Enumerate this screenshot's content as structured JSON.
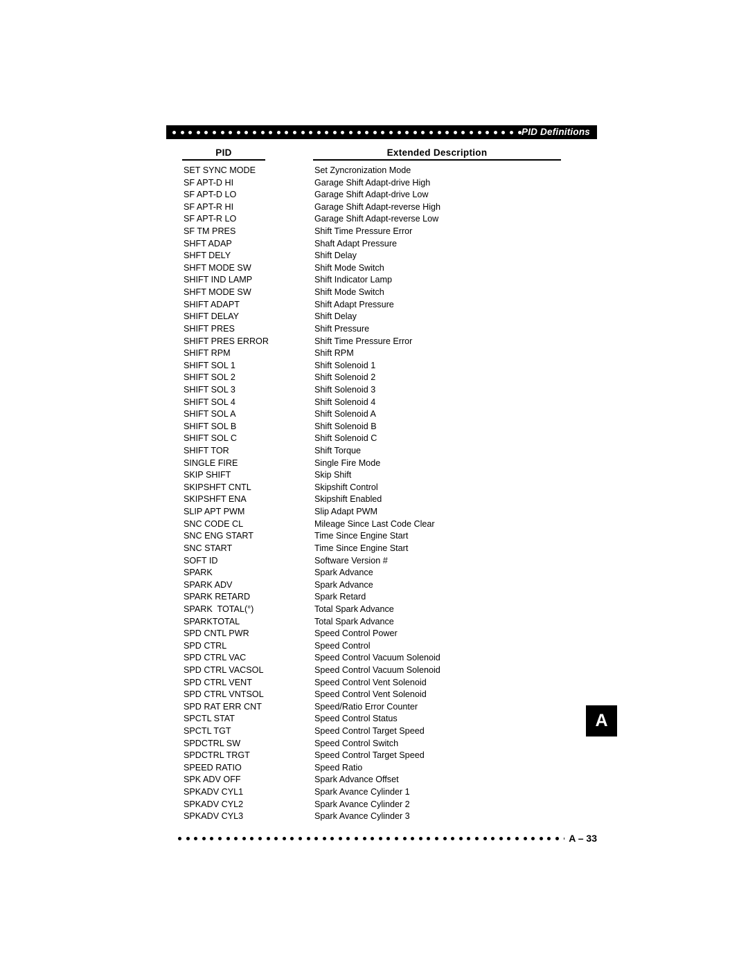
{
  "header": {
    "title": "PID Definitions",
    "dot_count": 47,
    "background_color": "#000000",
    "dot_color": "#ffffff"
  },
  "columns": {
    "pid_header": "PID",
    "description_header": "Extended Description"
  },
  "side_tab": {
    "label": "A",
    "background_color": "#000000",
    "text_color": "#ffffff"
  },
  "footer": {
    "page_label": "A – 33",
    "dot_count": 60,
    "dot_color": "#000000"
  },
  "rows": [
    {
      "pid": "SET SYNC MODE",
      "description": "Set Zyncronization Mode"
    },
    {
      "pid": "SF APT-D HI",
      "description": "Garage Shift Adapt-drive High"
    },
    {
      "pid": "SF APT-D LO",
      "description": "Garage Shift Adapt-drive Low"
    },
    {
      "pid": "SF APT-R HI",
      "description": "Garage Shift Adapt-reverse High"
    },
    {
      "pid": "SF APT-R LO",
      "description": "Garage Shift Adapt-reverse Low"
    },
    {
      "pid": "SF TM PRES",
      "description": "Shift Time Pressure Error"
    },
    {
      "pid": "SHFT ADAP",
      "description": "Shaft Adapt Pressure"
    },
    {
      "pid": "SHFT DELY",
      "description": "Shift Delay"
    },
    {
      "pid": "SHFT MODE SW",
      "description": "Shift Mode Switch"
    },
    {
      "pid": "SHIFT IND LAMP",
      "description": "Shift Indicator Lamp"
    },
    {
      "pid": "SHFT MODE SW",
      "description": "Shift Mode Switch"
    },
    {
      "pid": "SHIFT ADAPT",
      "description": "Shift Adapt Pressure"
    },
    {
      "pid": "SHIFT DELAY",
      "description": "Shift Delay"
    },
    {
      "pid": "SHIFT PRES",
      "description": "Shift Pressure"
    },
    {
      "pid": "SHIFT PRES ERROR",
      "description": "Shift Time Pressure Error"
    },
    {
      "pid": "SHIFT RPM",
      "description": "Shift RPM"
    },
    {
      "pid": "SHIFT SOL 1",
      "description": "Shift Solenoid 1"
    },
    {
      "pid": "SHIFT SOL 2",
      "description": "Shift Solenoid 2"
    },
    {
      "pid": "SHIFT SOL 3",
      "description": "Shift Solenoid 3"
    },
    {
      "pid": "SHIFT SOL 4",
      "description": "Shift Solenoid 4"
    },
    {
      "pid": "SHIFT SOL A",
      "description": "Shift Solenoid A"
    },
    {
      "pid": "SHIFT SOL B",
      "description": "Shift Solenoid B"
    },
    {
      "pid": "SHIFT SOL C",
      "description": "Shift Solenoid C"
    },
    {
      "pid": "SHIFT TOR",
      "description": "Shift Torque"
    },
    {
      "pid": "SINGLE FIRE",
      "description": "Single Fire Mode"
    },
    {
      "pid": "SKIP SHIFT",
      "description": "Skip Shift"
    },
    {
      "pid": "SKIPSHFT CNTL",
      "description": "Skipshift Control"
    },
    {
      "pid": "SKIPSHFT ENA",
      "description": "Skipshift Enabled"
    },
    {
      "pid": "SLIP APT PWM",
      "description": "Slip Adapt PWM"
    },
    {
      "pid": "SNC CODE CL",
      "description": "Mileage Since Last Code Clear"
    },
    {
      "pid": "SNC ENG START",
      "description": "Time Since Engine Start"
    },
    {
      "pid": "SNC START",
      "description": "Time Since Engine Start"
    },
    {
      "pid": "SOFT ID",
      "description": "Software Version #"
    },
    {
      "pid": "SPARK",
      "description": "Spark Advance"
    },
    {
      "pid": "SPARK ADV",
      "description": "Spark Advance"
    },
    {
      "pid": "SPARK RETARD",
      "description": "Spark Retard"
    },
    {
      "pid": "SPARK  TOTAL(°)",
      "description": "Total Spark Advance"
    },
    {
      "pid": "SPARKTOTAL",
      "description": "Total Spark Advance"
    },
    {
      "pid": "SPD CNTL PWR",
      "description": "Speed Control Power"
    },
    {
      "pid": "SPD CTRL",
      "description": "Speed Control"
    },
    {
      "pid": "SPD CTRL VAC",
      "description": "Speed Control Vacuum Solenoid"
    },
    {
      "pid": "SPD CTRL VACSOL",
      "description": "Speed Control Vacuum Solenoid"
    },
    {
      "pid": "SPD CTRL VENT",
      "description": "Speed Control Vent Solenoid"
    },
    {
      "pid": "SPD CTRL VNTSOL",
      "description": "Speed Control Vent Solenoid"
    },
    {
      "pid": "SPD RAT ERR CNT",
      "description": "Speed/Ratio Error Counter"
    },
    {
      "pid": "SPCTL STAT",
      "description": "Speed Control Status"
    },
    {
      "pid": "SPCTL TGT",
      "description": "Speed Control Target Speed"
    },
    {
      "pid": "SPDCTRL SW",
      "description": "Speed Control Switch"
    },
    {
      "pid": "SPDCTRL TRGT",
      "description": "Speed Control Target Speed"
    },
    {
      "pid": "SPEED RATIO",
      "description": "Speed Ratio"
    },
    {
      "pid": "SPK ADV OFF",
      "description": "Spark Advance Offset"
    },
    {
      "pid": "SPKADV CYL1",
      "description": "Spark Avance Cylinder 1"
    },
    {
      "pid": "SPKADV CYL2",
      "description": "Spark Avance Cylinder 2"
    },
    {
      "pid": "SPKADV CYL3",
      "description": "Spark Avance Cylinder 3"
    }
  ]
}
